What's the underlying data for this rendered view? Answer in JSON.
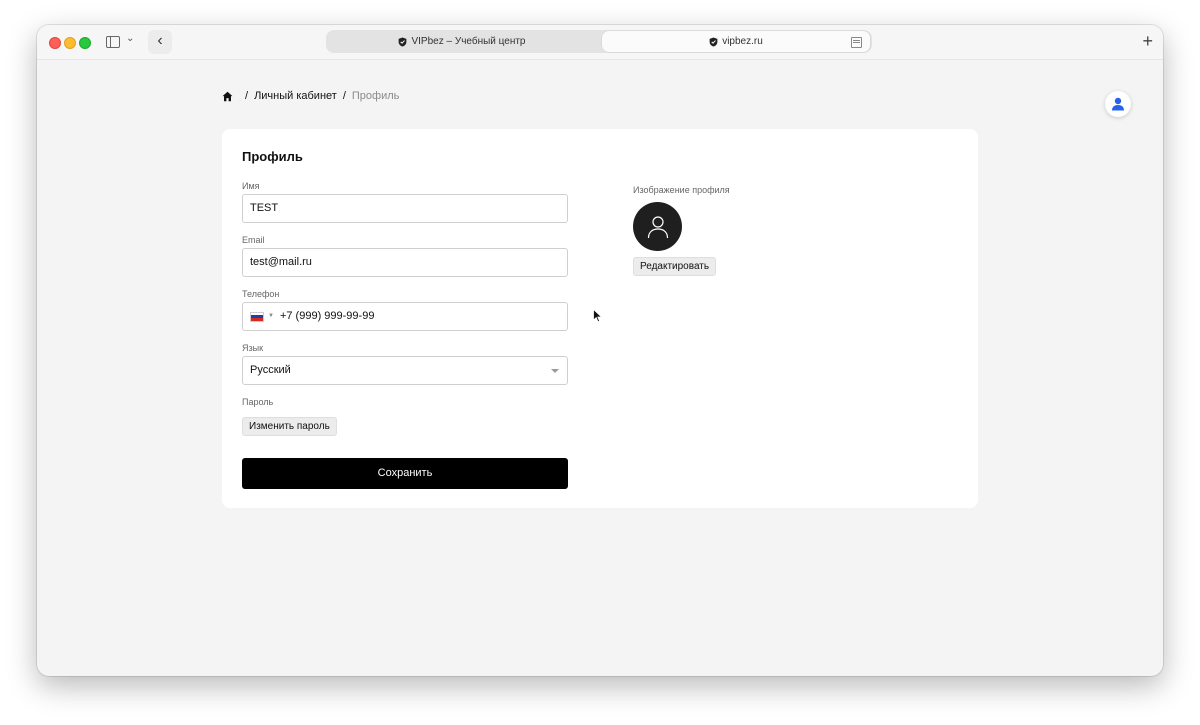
{
  "browser": {
    "tabs": [
      {
        "label": "VIPbez – Учебный центр"
      },
      {
        "label": "vipbez.ru"
      }
    ]
  },
  "breadcrumb": {
    "items": [
      "Личный кабинет",
      "Профиль"
    ],
    "separator": "/"
  },
  "profile_form": {
    "title": "Профиль",
    "name": {
      "label": "Имя",
      "value": "TEST"
    },
    "email": {
      "label": "Email",
      "value": "test@mail.ru"
    },
    "phone": {
      "label": "Телефон",
      "country": "RU",
      "value": "+7 (999) 999-99-99"
    },
    "language": {
      "label": "Язык",
      "selected": "Русский"
    },
    "password": {
      "label": "Пароль",
      "change_button": "Изменить пароль"
    },
    "save_button": "Сохранить"
  },
  "profile_image": {
    "label": "Изображение профиля",
    "edit_button": "Редактировать"
  },
  "colors": {
    "page_bg": "#f4f4f4",
    "card_bg": "#ffffff",
    "primary_button": "#000000",
    "user_icon_accent": "#2563eb"
  }
}
